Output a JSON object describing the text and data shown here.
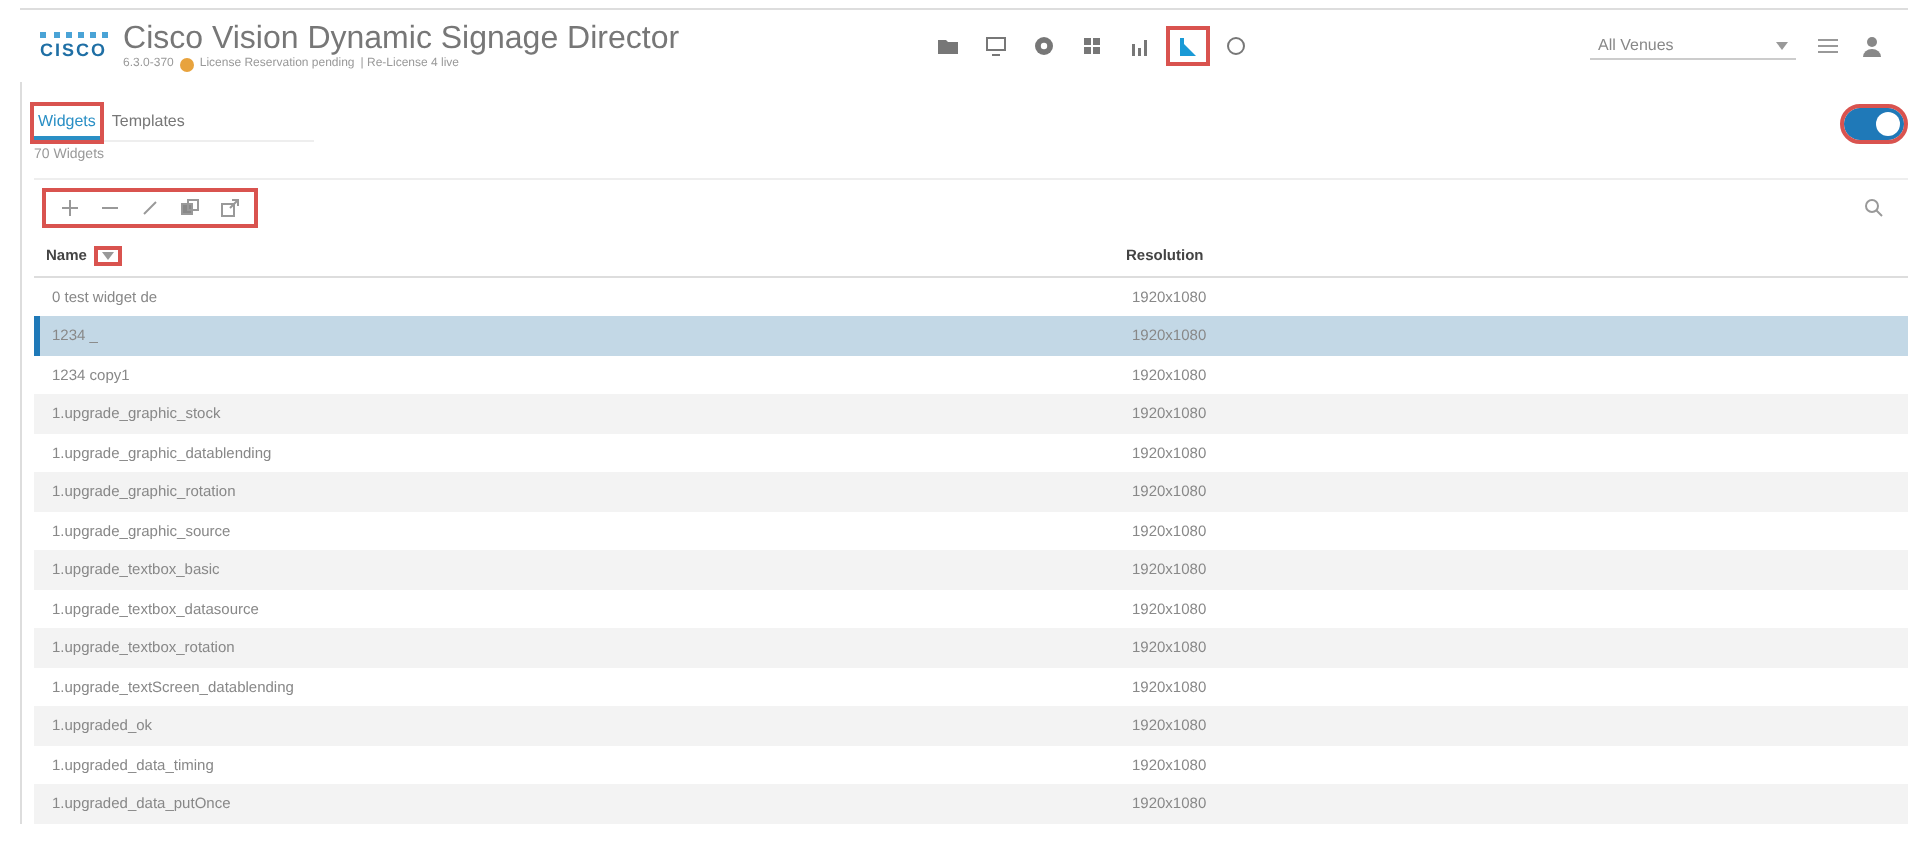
{
  "header": {
    "logo": "CISCO",
    "title": "Cisco Vision Dynamic Signage Director",
    "version": "6.3.0-370",
    "license": "License Reservation pending",
    "license_extra": "| Re-License 4 live",
    "nav": [
      {
        "kind": "folder",
        "selected": false
      },
      {
        "kind": "monitor",
        "selected": false
      },
      {
        "kind": "gear",
        "selected": false
      },
      {
        "kind": "grid",
        "selected": false
      },
      {
        "kind": "chart",
        "selected": false
      },
      {
        "kind": "widget",
        "selected": true
      },
      {
        "kind": "circle",
        "selected": false
      }
    ],
    "venue": "All Venues"
  },
  "tabs": [
    {
      "label": "Widgets",
      "selected": true
    },
    {
      "label": "Templates",
      "selected": false
    }
  ],
  "count": "70 Widgets",
  "view_toggle": {
    "on": true
  },
  "toolbar": [
    {
      "kind": "add"
    },
    {
      "kind": "remove"
    },
    {
      "kind": "edit"
    },
    {
      "kind": "copy"
    },
    {
      "kind": "export"
    }
  ],
  "table": {
    "columns": [
      "Name",
      "Resolution"
    ],
    "rows": [
      {
        "name": "0 test widget de",
        "resolution": "1920x1080",
        "selected": false
      },
      {
        "name": "1234 _",
        "resolution": "1920x1080",
        "selected": true
      },
      {
        "name": "1234 copy1",
        "resolution": "1920x1080",
        "selected": false
      },
      {
        "name": "1.upgrade_graphic_stock",
        "resolution": "1920x1080",
        "selected": false
      },
      {
        "name": "1.upgrade_graphic_datablending",
        "resolution": "1920x1080",
        "selected": false
      },
      {
        "name": "1.upgrade_graphic_rotation",
        "resolution": "1920x1080",
        "selected": false
      },
      {
        "name": "1.upgrade_graphic_source",
        "resolution": "1920x1080",
        "selected": false
      },
      {
        "name": "1.upgrade_textbox_basic",
        "resolution": "1920x1080",
        "selected": false
      },
      {
        "name": "1.upgrade_textbox_datasource",
        "resolution": "1920x1080",
        "selected": false
      },
      {
        "name": "1.upgrade_textbox_rotation",
        "resolution": "1920x1080",
        "selected": false
      },
      {
        "name": "1.upgrade_textScreen_datablending",
        "resolution": "1920x1080",
        "selected": false
      },
      {
        "name": "1.upgraded_ok",
        "resolution": "1920x1080",
        "selected": false
      },
      {
        "name": "1.upgraded_data_timing",
        "resolution": "1920x1080",
        "selected": false
      },
      {
        "name": "1.upgraded_data_putOnce",
        "resolution": "1920x1080",
        "selected": false
      }
    ]
  }
}
